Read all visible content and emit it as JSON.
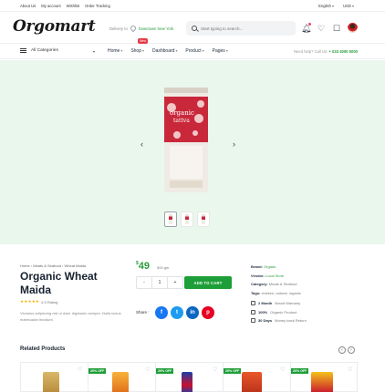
{
  "topbar": {
    "links": [
      "About Us",
      "My account",
      "Wishlist",
      "Order Tracking"
    ],
    "language": "English",
    "currency": "USD"
  },
  "header": {
    "logo": "Orgomart",
    "delivery_label": "Delivery to",
    "delivery_location": "Downtown New York",
    "search_placeholder": "Start typing to search..."
  },
  "nav": {
    "all_categories": "All Categories",
    "menu": [
      "Home",
      "Shop",
      "Dashboard",
      "Product",
      "Pages"
    ],
    "new_badge": "New",
    "help_label": "Need help? Call Us:",
    "help_phone": "+ 033 4000 5000"
  },
  "product": {
    "breadcrumb": [
      "Home",
      "Meats & Seafood",
      "Wheat Maida"
    ],
    "title": "Organic Wheat Maida",
    "rating_text": "4.5 Rating",
    "description": "Vivamus adipiscing nisl ut dolor dignissim semper. Nulla luctus malesuada tincidunt.",
    "currency_symbol": "$",
    "price": "49",
    "weight": "500 gm",
    "quantity": "1",
    "add_to_cart": "ADD TO CART",
    "share_label": "Share :"
  },
  "meta": {
    "brand_label": "Brand:",
    "brand": "Orgado",
    "vendor_label": "Vendor:",
    "vendor": "Local Store",
    "category_label": "Category:",
    "category": "Meats & Seafood",
    "tags_label": "Tags:",
    "tags": "chicken, natural, organic",
    "perks": [
      {
        "strong": "2 Month",
        "text": "Brand Warranty"
      },
      {
        "strong": "100%",
        "text": "Organic Product"
      },
      {
        "strong": "30 Days",
        "text": "Money back Return"
      }
    ]
  },
  "related": {
    "title": "Related Products",
    "badges": [
      "20% OFF",
      "20% OFF",
      "20% OFF",
      "20% OFF"
    ]
  },
  "colors": {
    "brand_green": "#1e9e38",
    "gallery_bg": "#eaf7ec",
    "facebook": "#1877f2",
    "twitter": "#1d9bf0",
    "linkedin": "#0a66c2",
    "pinterest": "#e60023"
  }
}
